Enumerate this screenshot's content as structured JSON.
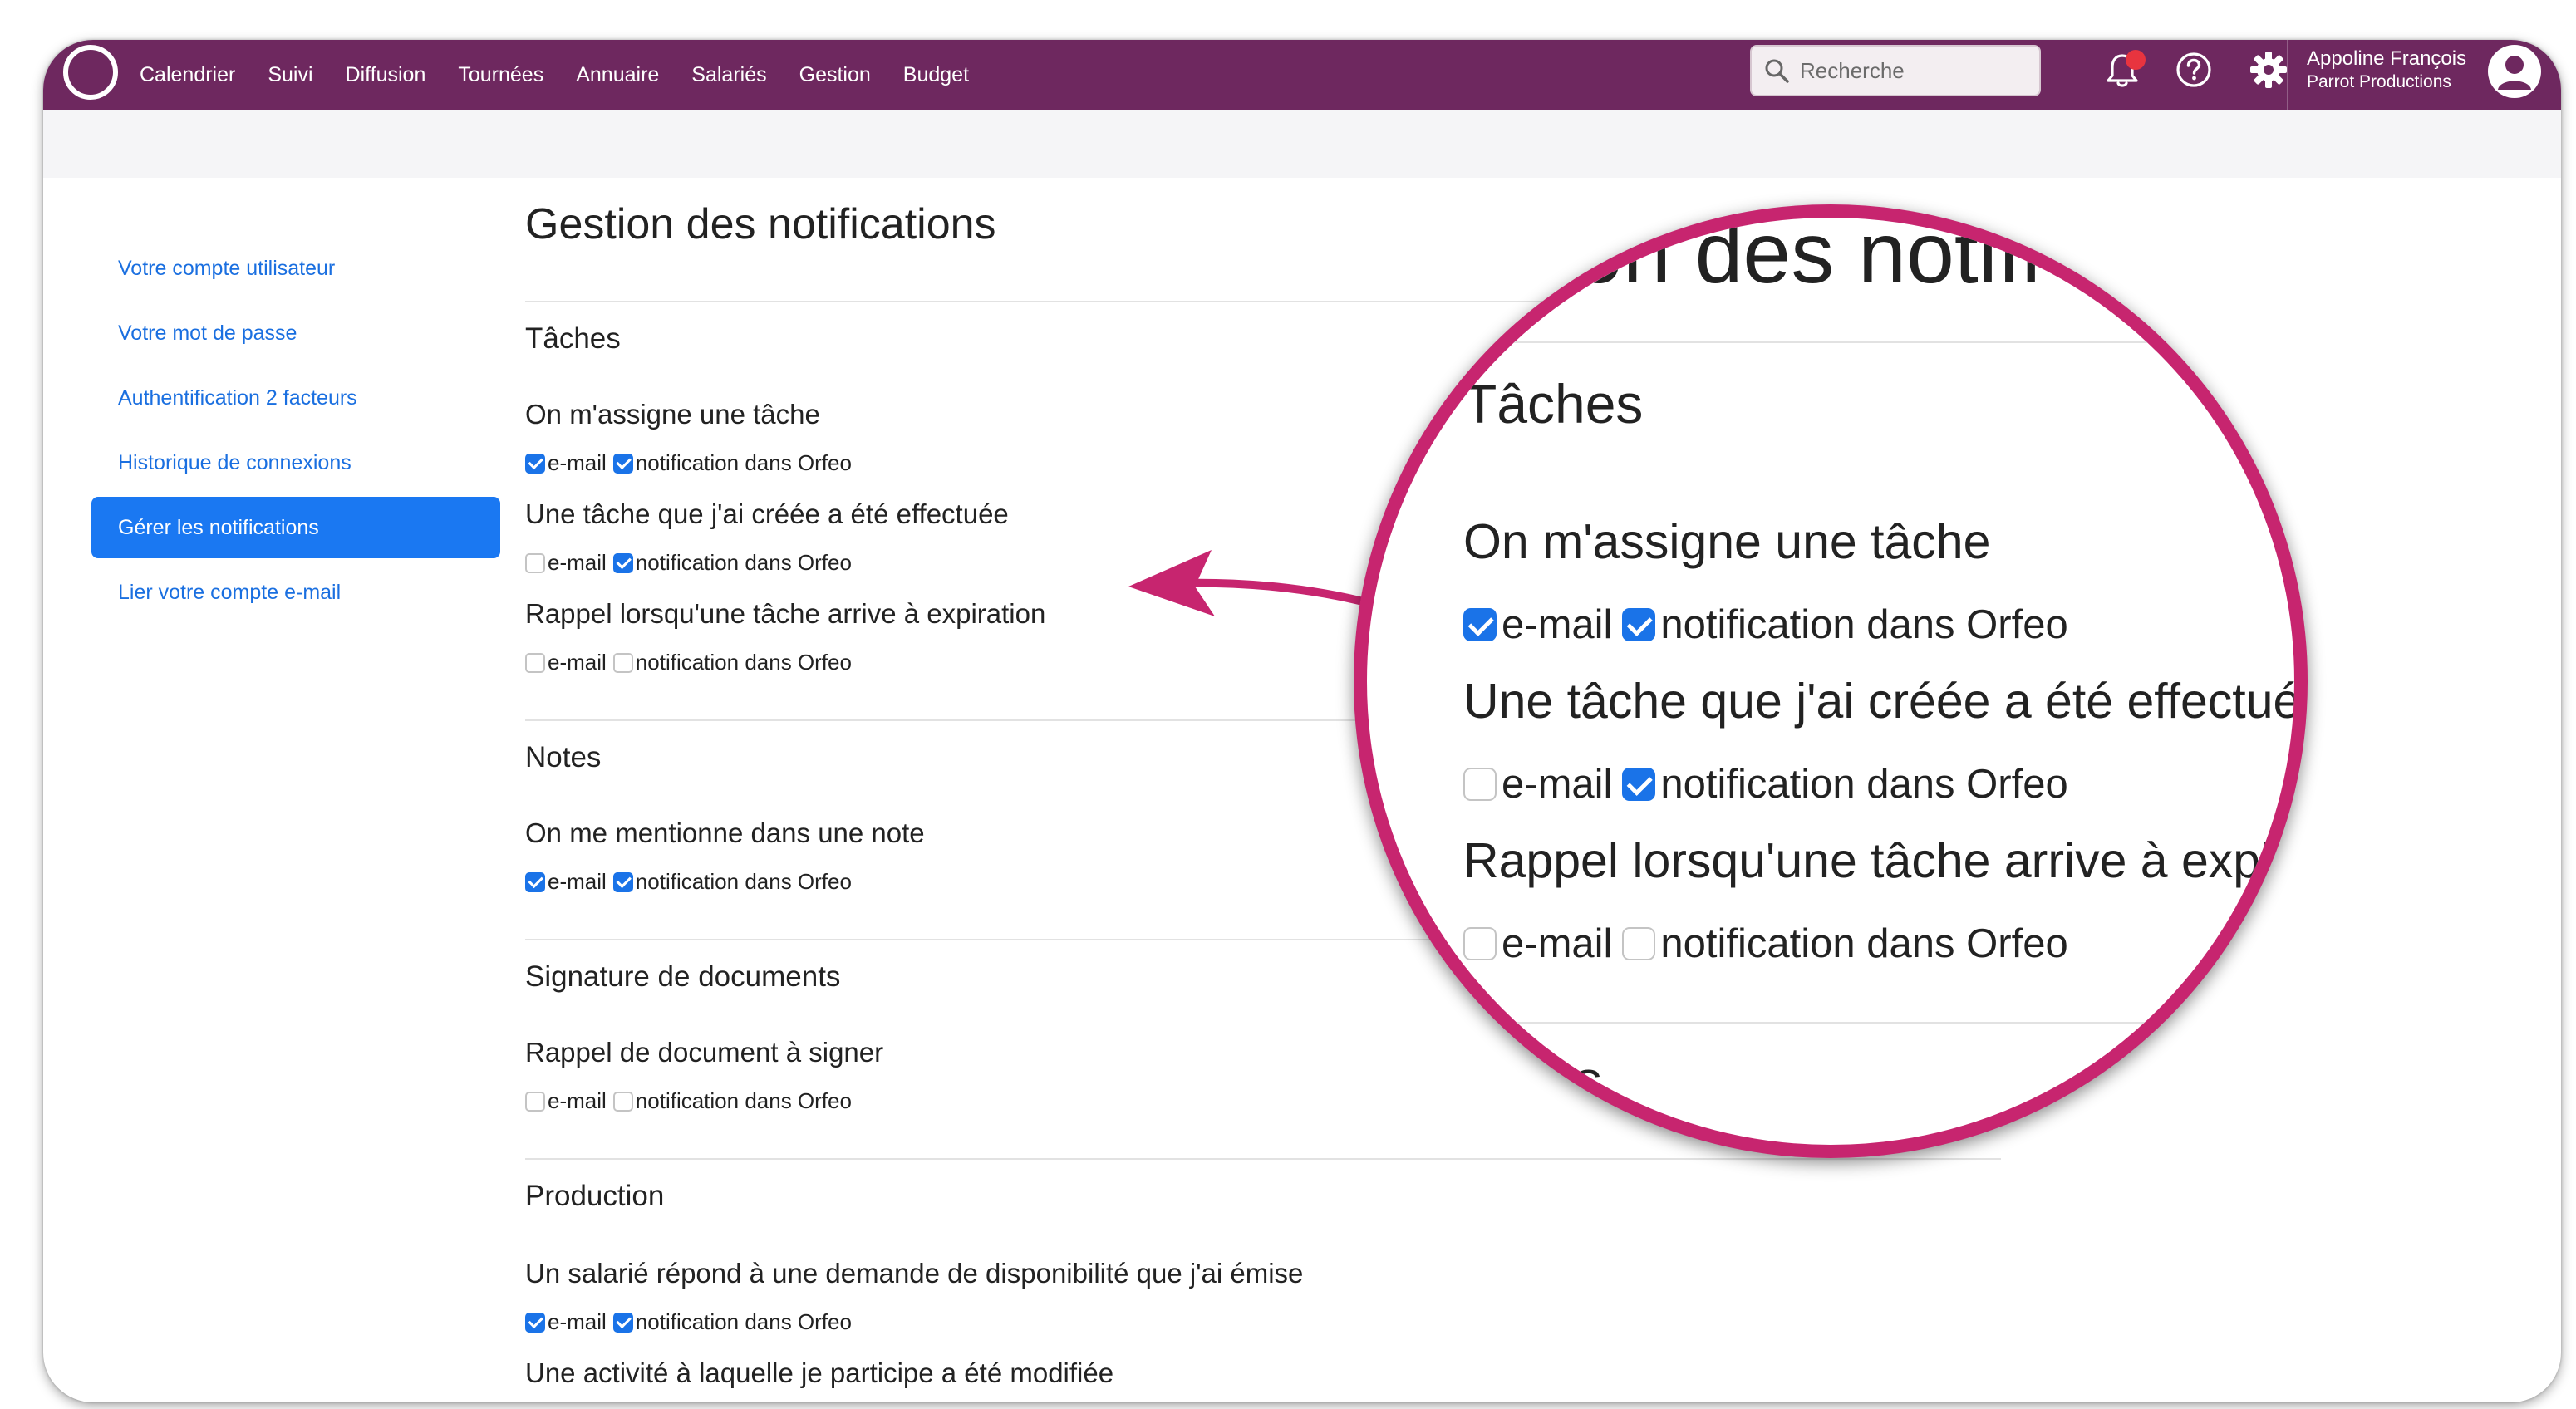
{
  "colors": {
    "navbar": "#6e285f",
    "accent": "#1a78f2",
    "link": "#1a6fe0",
    "magnifier_ring": "#c7256f",
    "notification_dot": "#e8343f"
  },
  "nav": {
    "logo_icon": "circle-logo-icon",
    "menu": [
      "Calendrier",
      "Suivi",
      "Diffusion",
      "Tournées",
      "Annuaire",
      "Salariés",
      "Gestion",
      "Budget"
    ],
    "search_placeholder": "Recherche",
    "icons": [
      "bell-icon",
      "help-icon",
      "gear-icon"
    ],
    "user_name": "Appoline François",
    "user_org": "Parrot Productions"
  },
  "sidebar": {
    "items": [
      {
        "label": "Votre compte utilisateur",
        "active": false
      },
      {
        "label": "Votre mot de passe",
        "active": false
      },
      {
        "label": "Authentification 2 facteurs",
        "active": false
      },
      {
        "label": "Historique de connexions",
        "active": false
      },
      {
        "label": "Gérer les notifications",
        "active": true
      },
      {
        "label": "Lier votre compte e-mail",
        "active": false
      }
    ]
  },
  "page": {
    "title": "Gestion des notifications",
    "email_label": "e-mail",
    "app_label": "notification dans Orfeo",
    "sections": [
      {
        "title": "Tâches",
        "items": [
          {
            "label": "On m'assigne une tâche",
            "email": true,
            "app": true
          },
          {
            "label": "Une tâche que j'ai créée a été effectuée",
            "email": false,
            "app": true
          },
          {
            "label": "Rappel lorsqu'une tâche arrive à expiration",
            "email": false,
            "app": false
          }
        ]
      },
      {
        "title": "Notes",
        "items": [
          {
            "label": "On me mentionne dans une note",
            "email": true,
            "app": true
          }
        ]
      },
      {
        "title": "Signature de documents",
        "items": [
          {
            "label": "Rappel de document à signer",
            "email": false,
            "app": false
          }
        ]
      },
      {
        "title": "Production",
        "items": [
          {
            "label": "Un salarié répond à une demande de disponibilité que j'ai émise",
            "email": true,
            "app": true
          },
          {
            "label": "Une activité à laquelle je participe a été modifiée"
          }
        ]
      }
    ]
  },
  "magnifier": {
    "title_fragment": "on des notifi",
    "section_title": "Tâches",
    "items": [
      {
        "label": "On m'assigne une tâche",
        "email": true,
        "app": true
      },
      {
        "label": "Une tâche que j'ai créée a été effectuée",
        "email": false,
        "app": true
      },
      {
        "label": "Rappel lorsqu'une tâche arrive à expiration",
        "email": false,
        "app": false
      }
    ],
    "next_fragment": "s"
  }
}
